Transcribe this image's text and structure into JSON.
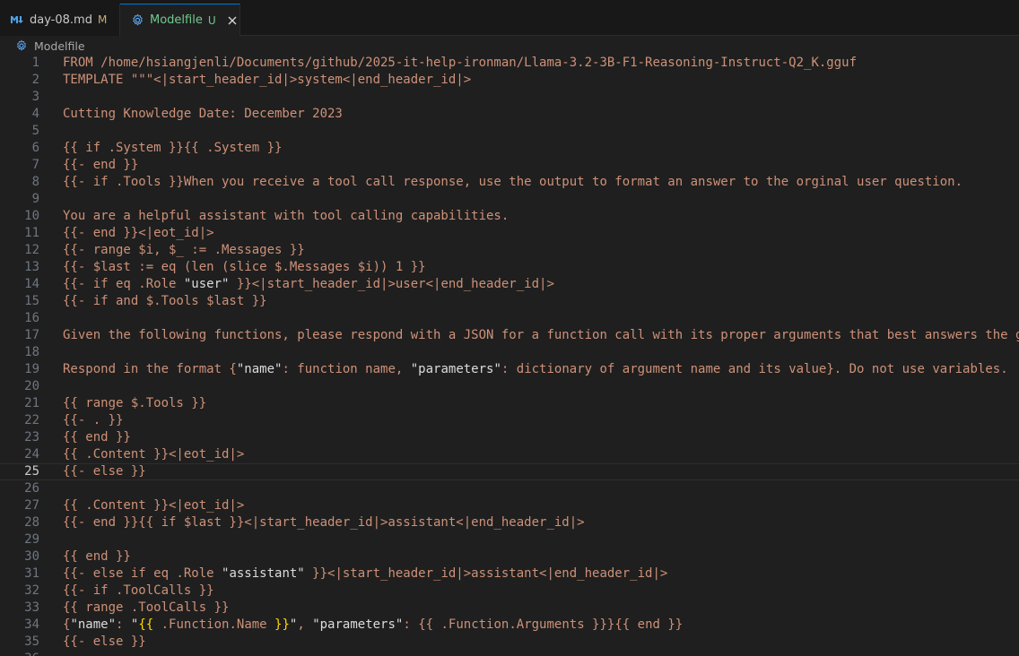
{
  "tabs": [
    {
      "label": "day-08.md",
      "badge": "M",
      "icon": "markdown-icon"
    },
    {
      "label": "Modelfile",
      "badge": "U",
      "icon": "gear-icon",
      "active": true
    }
  ],
  "breadcrumb": {
    "label": "Modelfile",
    "icon": "gear-icon"
  },
  "current_line": 25,
  "lines": [
    "FROM /home/hsiangjenli/Documents/github/2025-it-help-ironman/Llama-3.2-3B-F1-Reasoning-Instruct-Q2_K.gguf",
    "TEMPLATE \"\"\"<|start_header_id|>system<|end_header_id|>",
    "",
    "Cutting Knowledge Date: December 2023",
    "",
    "{{ if .System }}{{ .System }}",
    "{{- end }}",
    "{{- if .Tools }}When you receive a tool call response, use the output to format an answer to the orginal user question.",
    "",
    "You are a helpful assistant with tool calling capabilities.",
    "{{- end }}<|eot_id|>",
    "{{- range $i, $_ := .Messages }}",
    "{{- $last := eq (len (slice $.Messages $i)) 1 }}",
    "{{- if eq .Role \"user\" }}<|start_header_id|>user<|end_header_id|>",
    "{{- if and $.Tools $last }}",
    "",
    "Given the following functions, please respond with a JSON for a function call with its proper arguments that best answers the g",
    "",
    "Respond in the format {\"name\": function name, \"parameters\": dictionary of argument name and its value}. Do not use variables.",
    "",
    "{{ range $.Tools }}",
    "{{- . }}",
    "{{ end }}",
    "{{ .Content }}<|eot_id|>",
    "{{- else }}",
    "",
    "{{ .Content }}<|eot_id|>",
    "{{- end }}{{ if $last }}<|start_header_id|>assistant<|end_header_id|>",
    "",
    "{{ end }}",
    "{{- else if eq .Role \"assistant\" }}<|start_header_id|>assistant<|end_header_id|>",
    "{{- if .ToolCalls }}",
    "{{ range .ToolCalls }}",
    "{\"name\": \"{{ .Function.Name }}\", \"parameters\": {{ .Function.Arguments }}}{{ end }}",
    "{{- else }}",
    ""
  ],
  "colors": {
    "string": "#ce9178",
    "quote": "#dcdcdc",
    "bracket": "#ffd700",
    "tab_active": "#73c991"
  }
}
